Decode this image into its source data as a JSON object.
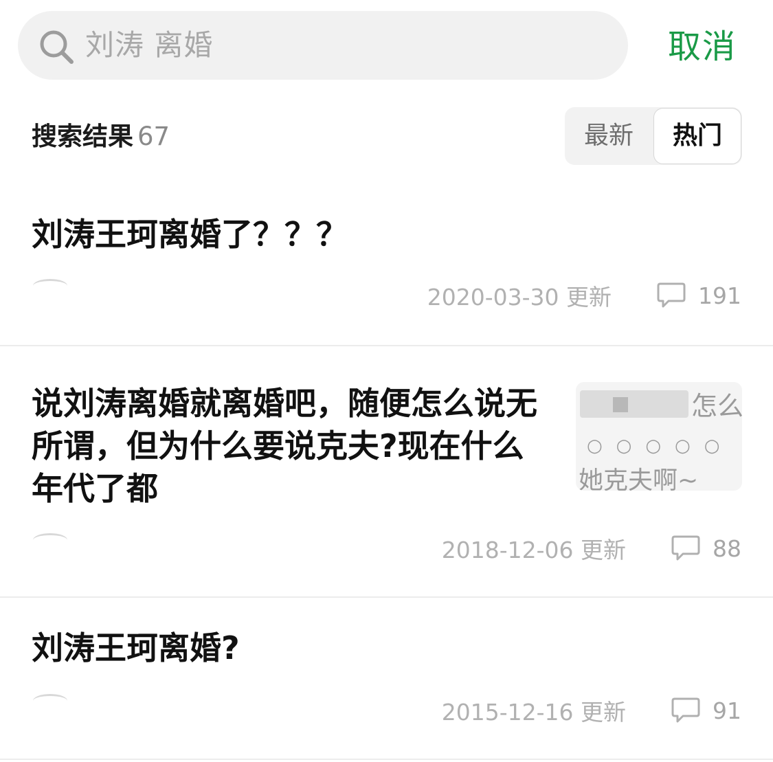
{
  "search": {
    "query": "刘涛 离婚",
    "cancel_label": "取消"
  },
  "results": {
    "label": "搜索结果",
    "count": "67",
    "sort_tabs": [
      {
        "label": "最新",
        "selected": false
      },
      {
        "label": "热门",
        "selected": true
      }
    ]
  },
  "posts": [
    {
      "title": "刘涛王珂离婚了？？？",
      "updated": "2020-03-30 更新",
      "comments": "191"
    },
    {
      "title": "说刘涛离婚就离婚吧，随便怎么说无所谓，但为什么要说克夫?现在什么年代了都",
      "updated": "2018-12-06 更新",
      "comments": "88",
      "thumbnail": {
        "top_text": "怎么",
        "dots": "○○○○○",
        "bottom_text": "她克夫啊~"
      }
    },
    {
      "title": "刘涛王珂离婚?",
      "updated": "2015-12-16 更新",
      "comments": "91"
    }
  ],
  "colors": {
    "accent": "#1a9a47",
    "meta_text": "#b1b1b1",
    "search_bg": "#f1f1f1"
  },
  "icons": {
    "search": "search-icon",
    "comment": "comment-icon"
  }
}
